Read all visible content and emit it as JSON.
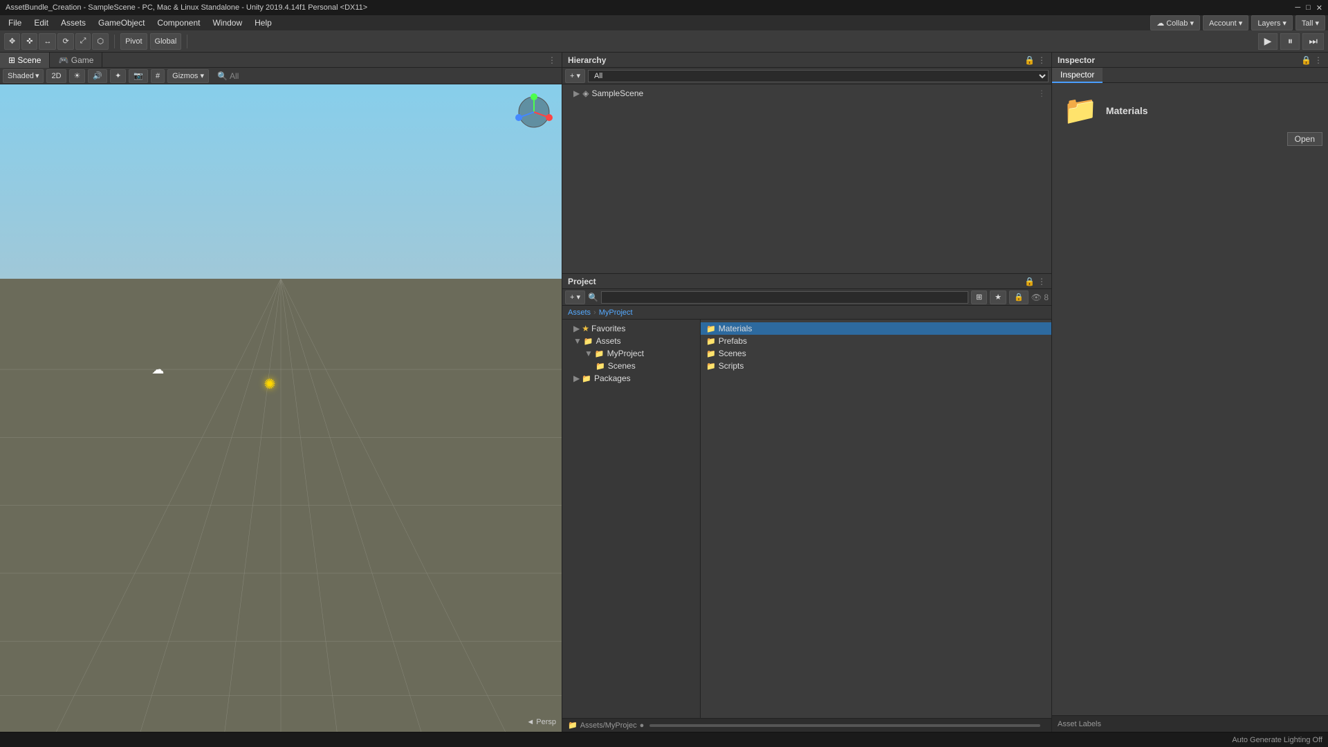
{
  "titlebar": {
    "text": "AssetBundle_Creation - SampleScene - PC, Mac & Linux Standalone - Unity 2019.4.14f1 Personal <DX11>"
  },
  "menubar": {
    "items": [
      "File",
      "Edit",
      "Assets",
      "GameObject",
      "Component",
      "Window",
      "Help"
    ]
  },
  "toolbar": {
    "transform_tools": [
      "✥",
      "✜",
      "↔",
      "⟳",
      "⤢",
      "⬡"
    ],
    "pivot_label": "Pivot",
    "global_label": "Global",
    "play_icon": "▶",
    "pause_icon": "⏸",
    "step_icon": "⏭",
    "collab_label": "Collab ▾",
    "account_label": "Account ▾",
    "layers_label": "Layers ▾",
    "layout_label": "Tall ▾"
  },
  "scene": {
    "tabs": [
      "Scene",
      "Game"
    ],
    "active_tab": "Scene",
    "shading_label": "Shaded",
    "mode_2d": "2D",
    "gizmos_label": "Gizmos ▾",
    "all_label": "All",
    "persp_label": "◄ Persp"
  },
  "hierarchy": {
    "title": "Hierarchy",
    "search_placeholder": "All",
    "scene_name": "SampleScene"
  },
  "project": {
    "title": "Project",
    "search_placeholder": "",
    "breadcrumb": {
      "assets": "Assets",
      "myproject": "MyProject"
    },
    "tree": {
      "favorites_label": "Favorites",
      "assets_label": "Assets",
      "myproject_label": "MyProject",
      "scenes_label": "Scenes",
      "packages_label": "Packages"
    },
    "files": [
      {
        "name": "Materials",
        "selected": true
      },
      {
        "name": "Prefabs",
        "selected": false
      },
      {
        "name": "Scenes",
        "selected": false
      },
      {
        "name": "Scripts",
        "selected": false
      }
    ],
    "status_bar": "Assets/MyProjec"
  },
  "inspector": {
    "title": "Inspector",
    "tab_label": "Inspector",
    "folder_name": "Materials",
    "open_label": "Open",
    "asset_labels": "Asset Labels"
  },
  "statusbar": {
    "text": "Auto Generate Lighting Off"
  }
}
